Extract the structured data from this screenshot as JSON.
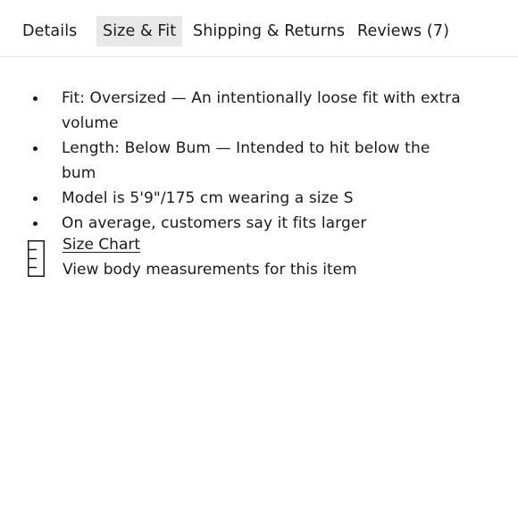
{
  "tabs": [
    {
      "label": "Details",
      "active": false
    },
    {
      "label": "Size & Fit",
      "active": true
    },
    {
      "label": "Shipping & Returns",
      "active": false
    },
    {
      "label": "Reviews (7)",
      "active": false
    }
  ],
  "fit_notes": [
    "Fit: Oversized — An intentionally loose fit with extra volume",
    "Length: Below Bum — Intended to hit below the bum",
    "Model is 5'9\"/175 cm wearing a size S",
    "On average, customers say it fits larger"
  ],
  "size_chart": {
    "icon": "ruler-icon",
    "link_label": "Size Chart",
    "description": "View body measurements for this item"
  },
  "colors": {
    "active_tab_bg": "#e8e8e8",
    "text": "#1a1a1a",
    "divider": "#e6e6e6"
  }
}
